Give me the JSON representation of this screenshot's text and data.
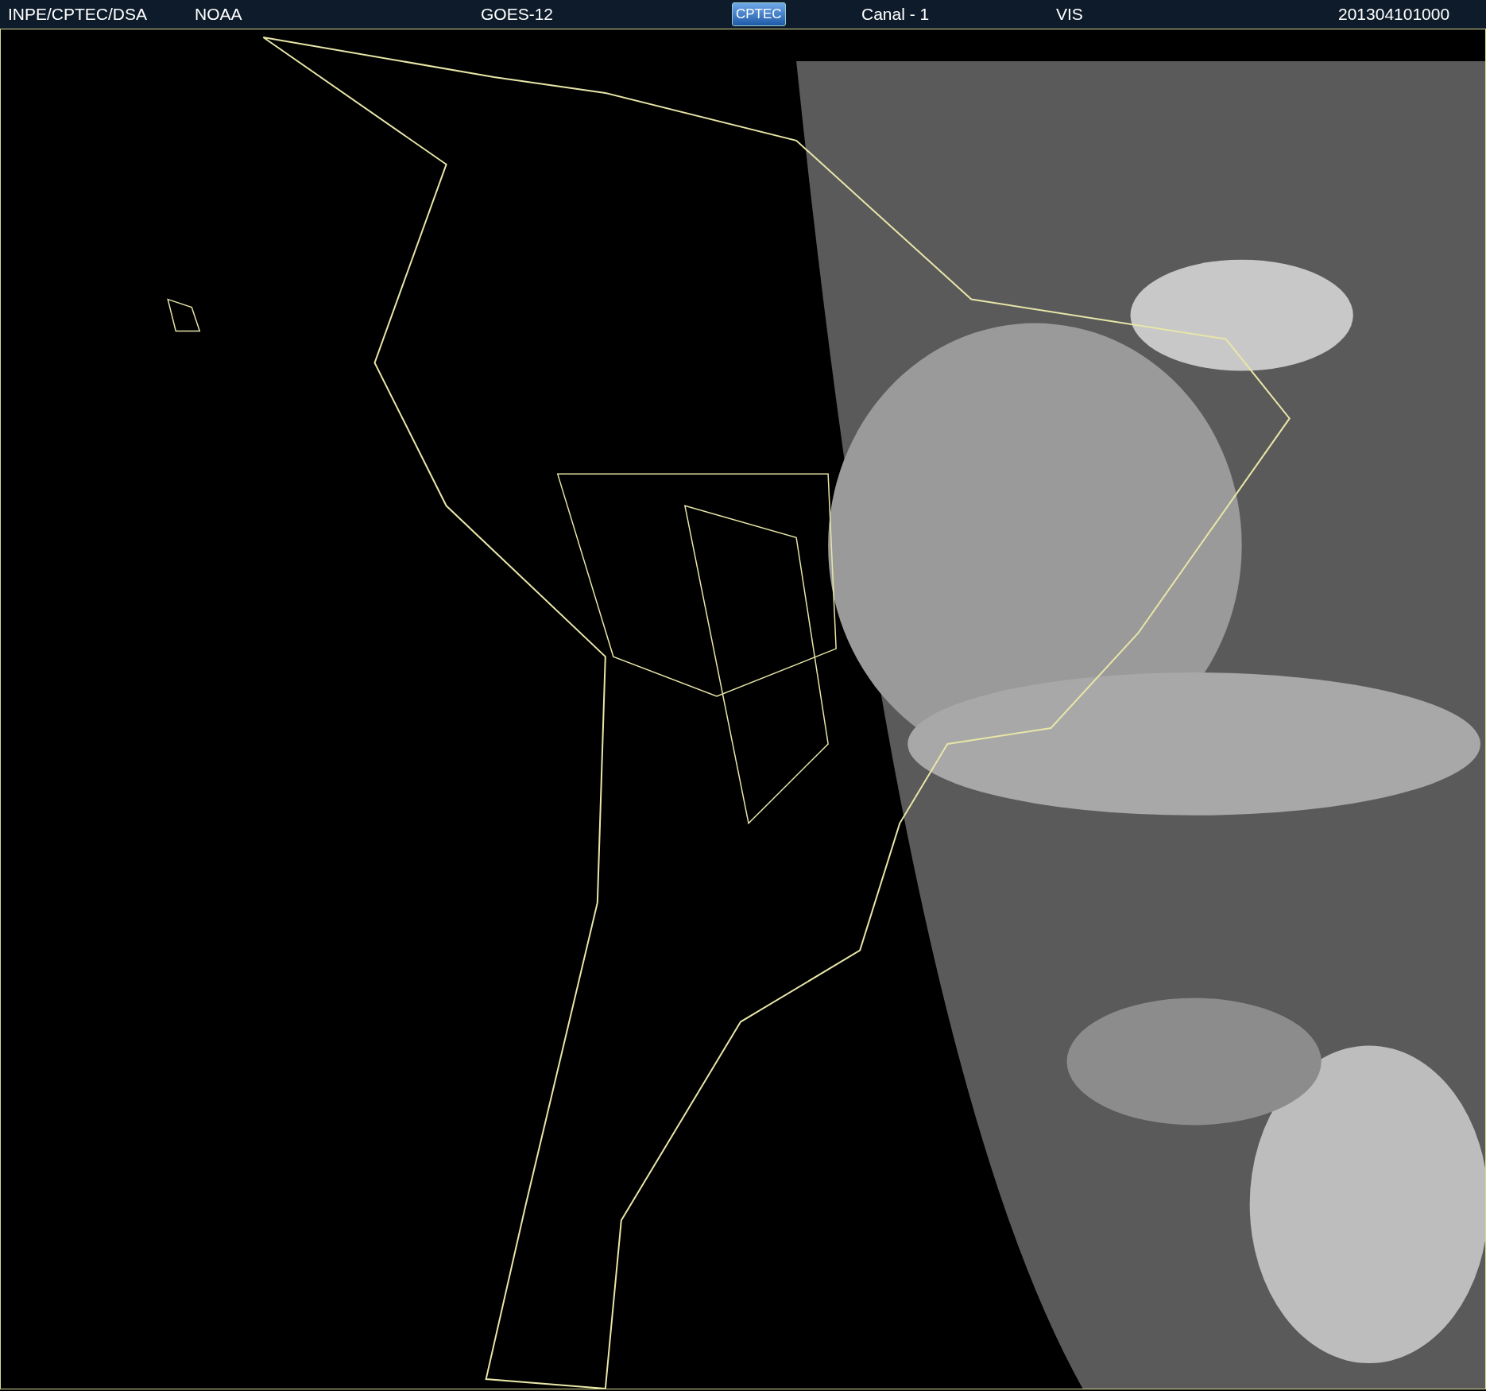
{
  "header": {
    "items": [
      {
        "kind": "text",
        "text": "INPE/CPTEC/DSA"
      },
      {
        "kind": "text",
        "text": "NOAA"
      },
      {
        "kind": "text",
        "text": "GOES-12"
      },
      {
        "kind": "logo",
        "text": "CPTEC"
      },
      {
        "kind": "text",
        "text": "Canal - 1"
      },
      {
        "kind": "text",
        "text": "VIS"
      },
      {
        "kind": "text",
        "text": "201304101000"
      }
    ]
  }
}
